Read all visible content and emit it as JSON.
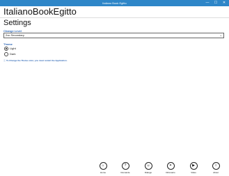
{
  "window": {
    "title": "Italiano Book Egitto",
    "controls": {
      "minimize": "—",
      "maximize": "☐",
      "close": "✕"
    }
  },
  "header": {
    "app_title": "ItalianoBookEgitto",
    "page_title": "Settings"
  },
  "level": {
    "label": "Change Level",
    "value_num": "2",
    "value_sup": "ND",
    "value_text": "Secondary",
    "chevron": "⌄"
  },
  "theme": {
    "label": "Theme",
    "options": [
      {
        "label": "Light",
        "selected": true
      },
      {
        "label": "Dark",
        "selected": false
      }
    ]
  },
  "info": {
    "icon": "ⓘ",
    "text": "To Change the Theme color, you must restart the Application."
  },
  "appbar": {
    "buttons": [
      {
        "label": "Home",
        "icon": "home-icon",
        "glyph": "⌂"
      },
      {
        "label": "Domande",
        "icon": "question-icon",
        "glyph": "?"
      },
      {
        "label": "Dialogo",
        "icon": "chat-icon",
        "glyph": "☺"
      },
      {
        "label": "Dizionario",
        "icon": "link-icon",
        "glyph": "⚭"
      },
      {
        "label": "Video",
        "icon": "video-icon",
        "glyph": "▶"
      },
      {
        "label": "About",
        "icon": "info-icon",
        "glyph": "i"
      }
    ]
  },
  "colors": {
    "titlebar": "#2e86c8",
    "accent": "#2a64b4"
  }
}
